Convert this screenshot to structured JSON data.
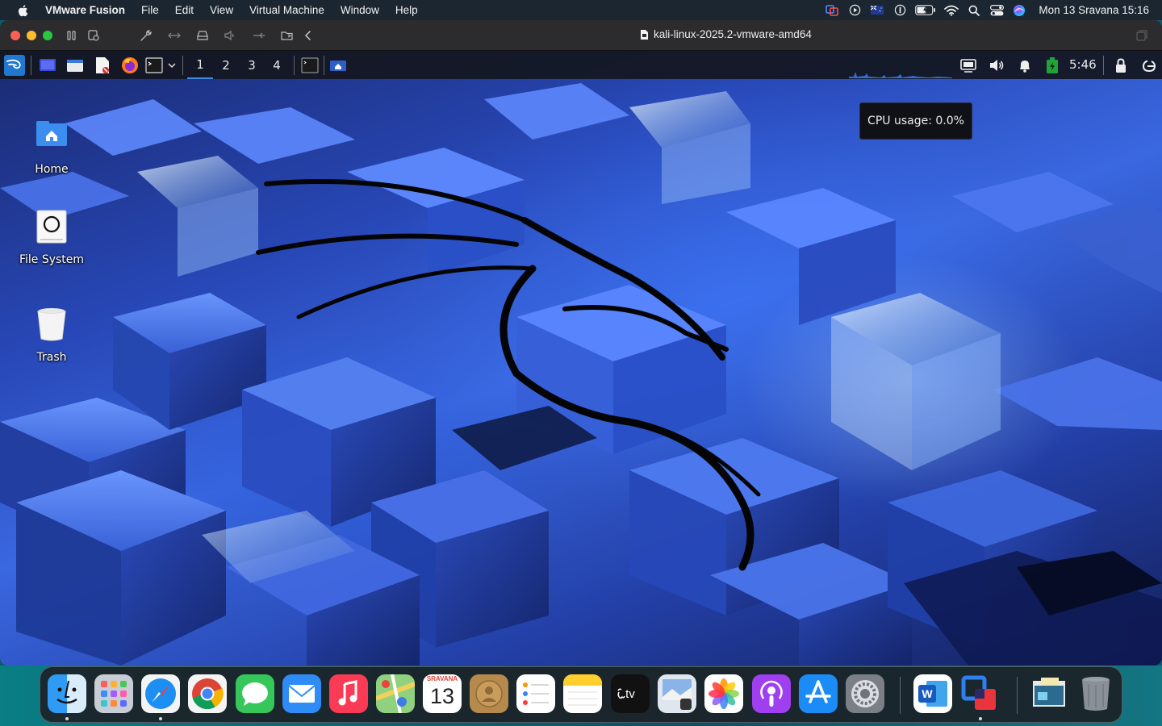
{
  "mac_menubar": {
    "app_name": "VMware Fusion",
    "menus": [
      "File",
      "Edit",
      "View",
      "Virtual Machine",
      "Window",
      "Help"
    ],
    "clock": "Mon 13 Sravana  15:16"
  },
  "vm_window": {
    "title": "kali-linux-2025.2-vmware-amd64"
  },
  "xfce_panel": {
    "workspaces": [
      "1",
      "2",
      "3",
      "4"
    ],
    "active_workspace": "1",
    "clock": "5:46",
    "tooltip": "CPU usage: 0.0%"
  },
  "desktop_icons": [
    {
      "label": "Home",
      "icon": "home-folder-icon"
    },
    {
      "label": "File System",
      "icon": "drive-icon"
    },
    {
      "label": "Trash",
      "icon": "trash-icon"
    }
  ],
  "dock": {
    "calendar_month": "SRAVANA",
    "calendar_day": "13",
    "apps": [
      "Finder",
      "Launchpad",
      "Safari",
      "Chrome",
      "Messages",
      "Mail",
      "Music",
      "Maps",
      "Calendar",
      "Contacts",
      "Reminders",
      "Notes",
      "TV",
      "Preview",
      "Photos",
      "Podcasts",
      "App Store",
      "System Settings",
      "Word",
      "VMware Fusion",
      "Downloads",
      "Trash"
    ]
  },
  "colors": {
    "accent": "#3d8de0",
    "menubar": "#1c2631",
    "panel": "#14161e"
  }
}
